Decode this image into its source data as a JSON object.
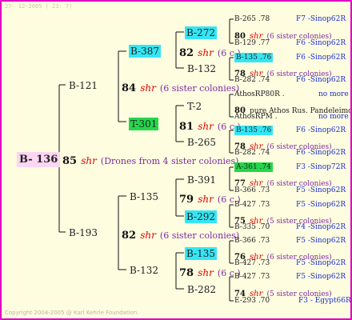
{
  "header": "27- 12-2005 ( 23: 7)",
  "footer": "Copyright 2004-2005 @ Karl Kehrle Foundation.",
  "root": {
    "id": "B- 136",
    "num": "85",
    "shr": "shr",
    "note": "(Drones from 4 sister colonies)"
  },
  "gen1": [
    {
      "id": "B-121",
      "num": "84",
      "shr": "shr",
      "note": "(6 sister colonies)"
    },
    {
      "id": "B-193",
      "num": "82",
      "shr": "shr",
      "note": "(6 sister colonies)"
    }
  ],
  "gen2": [
    {
      "id": "B-387",
      "num": "82",
      "shr": "shr",
      "note": "(6 c.)"
    },
    {
      "id": "T-301",
      "num": "81",
      "shr": "shr",
      "note": "(6 c.)"
    },
    {
      "id": "B-135",
      "num": "79",
      "shr": "shr",
      "note": "(6 c.)"
    },
    {
      "id": "B-132",
      "num": "78",
      "shr": "shr",
      "note": "(6 c.)"
    }
  ],
  "gen3": [
    "B-272",
    "B-132",
    "T-2",
    "B-265",
    "B-391",
    "B-292",
    "B-135",
    "B-282"
  ],
  "gen4_rows": [
    {
      "left": "B-265 .78",
      "right": "F7 -Sinop62R"
    },
    {
      "num": "80",
      "shr": "shr",
      "note": "(6 sister colonies)"
    },
    {
      "left": "B-129 .77",
      "right": "F6 -Sinop62R"
    },
    {
      "left": "B-135 .76",
      "right": "F6 -Sinop62R"
    },
    {
      "num": "78",
      "shr": "shr",
      "note": "(6 sister colonies)"
    },
    {
      "left": "B-282 .74",
      "right": "F6 -Sinop62R"
    },
    {
      "left": "AthosRP80R .",
      "right": "no more"
    },
    {
      "num": "80",
      "text": "pure Athos Rus. Pandeleimonos"
    },
    {
      "left": "AthosRPM .",
      "right": "no more"
    },
    {
      "left": "B-135 .76",
      "right": "F6 -Sinop62R"
    },
    {
      "num": "78",
      "shr": "shr",
      "note": "(6 sister colonies)"
    },
    {
      "left": "B-282 .74",
      "right": "F6 -Sinop62R"
    },
    {
      "left": "A-361 .74",
      "right": "F3 -Sinop72R"
    },
    {
      "num": "77",
      "shr": "shr",
      "note": "(6 sister colonies)"
    },
    {
      "left": "B-366 .73",
      "right": "F5 -Sinop62R"
    },
    {
      "left": "B-427 .73",
      "right": "F5 -Sinop62R"
    },
    {
      "num": "75",
      "shr": "shr",
      "note": "(5 sister colonies)"
    },
    {
      "left": "B-335 .70",
      "right": "F4 -Sinop62R"
    },
    {
      "left": "B-366 .73",
      "right": "F5 -Sinop62R"
    },
    {
      "num": "76",
      "shr": "shr",
      "note": "(6 sister colonies)"
    },
    {
      "left": "B-427 .73",
      "right": "F5 -Sinop62R"
    },
    {
      "left": "B-427 .73",
      "right": "F5 -Sinop62R"
    },
    {
      "num": "74",
      "shr": "shr",
      "note": "(5 sister colonies)"
    },
    {
      "left": "E-293 .70",
      "right": "F3 - Egypt66R"
    }
  ],
  "colors": {
    "frame": "#e000c0",
    "background": "#fffde0",
    "cyan": "#33e6f5",
    "green": "#22d84a",
    "pink": "#fcd6f2",
    "shr": "#e00000",
    "note": "#7a2aa0",
    "lineage": "#1a2fd0"
  }
}
